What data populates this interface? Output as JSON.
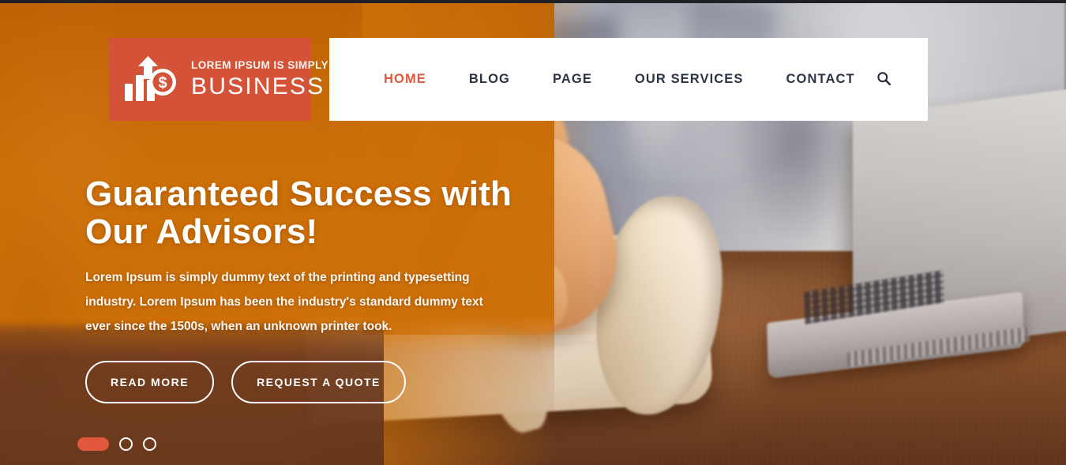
{
  "brand": {
    "tagline": "LOREM IPSUM IS SIMPLY",
    "name": "BUSINESS",
    "logo_icon": "bar-chart-arrow-coin-icon",
    "logo_bg_color": "#d35238"
  },
  "nav": {
    "items": [
      {
        "label": "HOME",
        "active": true
      },
      {
        "label": "BLOG",
        "active": false
      },
      {
        "label": "PAGE",
        "active": false
      },
      {
        "label": "OUR SERVICES",
        "active": false
      },
      {
        "label": "CONTACT",
        "active": false
      }
    ],
    "search_icon": "search-icon",
    "active_color": "#e1573c",
    "text_color": "#2b3443",
    "bar_color": "#ffffff"
  },
  "hero": {
    "title": "Guaranteed Success with Our Advisors!",
    "description": "Lorem Ipsum is simply dummy text of the printing and typesetting industry. Lorem Ipsum has been the industry's standard dummy text ever since the 1500s, when an unknown printer took.",
    "buttons": [
      {
        "label": "READ MORE"
      },
      {
        "label": "REQUEST A QUOTE"
      }
    ],
    "overlay_color": "#cd6f07",
    "desk_color": "#6d3b24",
    "text_color": "#ffffff"
  },
  "carousel": {
    "slides": 3,
    "active_index": 0,
    "active_color": "#e1573c",
    "inactive_color": "#ffffff"
  }
}
